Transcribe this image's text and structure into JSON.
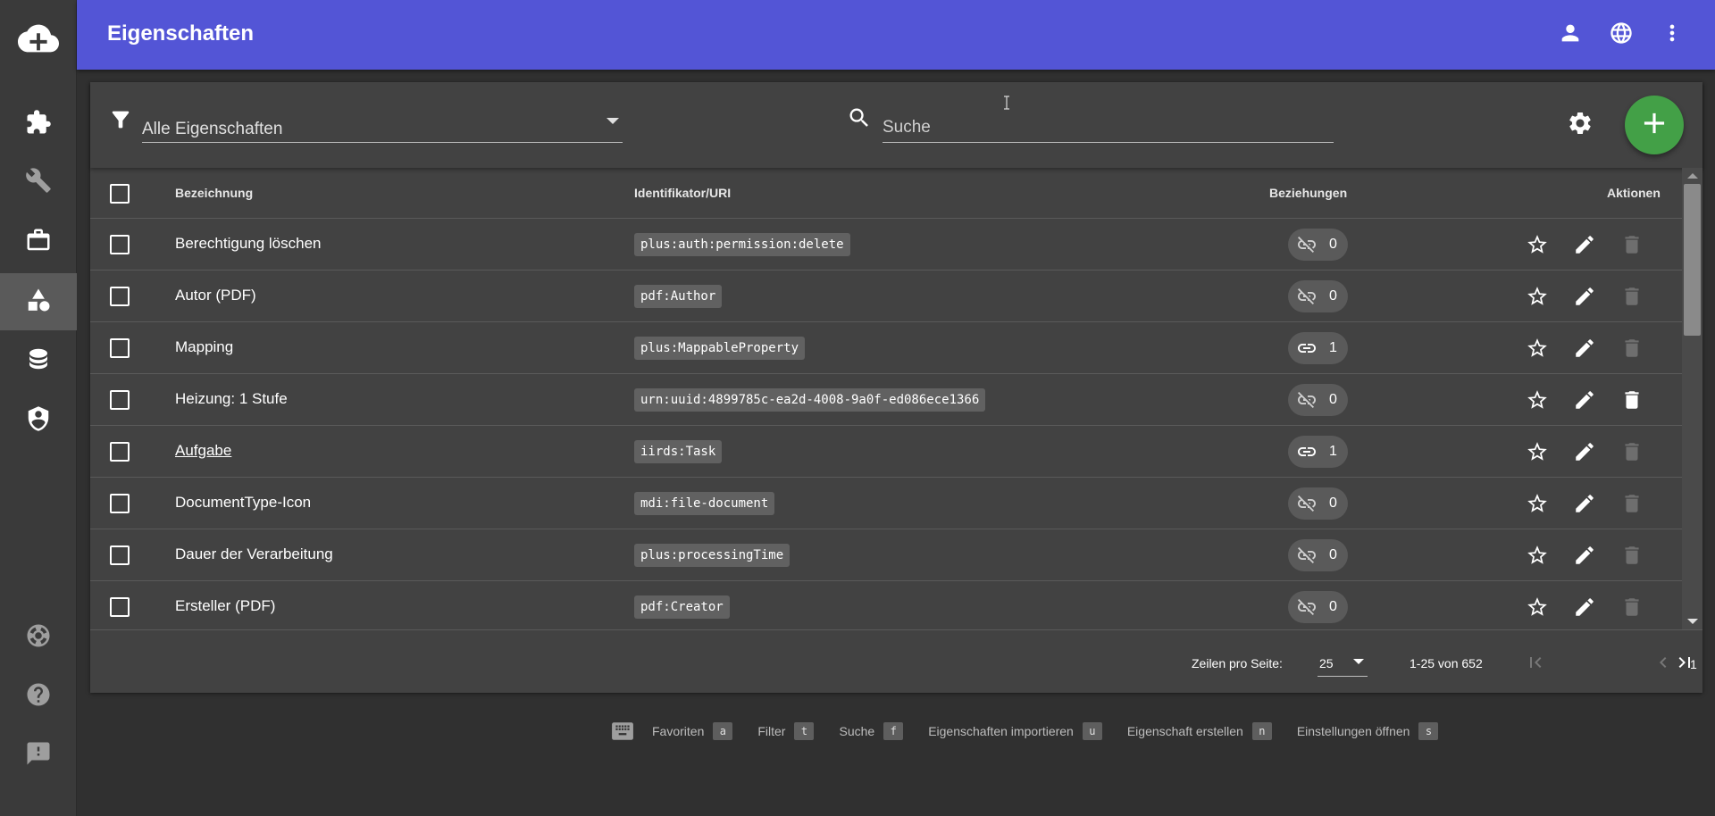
{
  "app": {
    "title": "Eigenschaften"
  },
  "sidebar": {
    "items": [
      {
        "name": "extensions",
        "icon": "puzzle-icon"
      },
      {
        "name": "tools",
        "icon": "wrench-icon"
      },
      {
        "name": "workspace",
        "icon": "briefcase-icon"
      },
      {
        "name": "properties",
        "icon": "shapes-icon",
        "active": true
      },
      {
        "name": "database",
        "icon": "database-icon"
      },
      {
        "name": "security",
        "icon": "shield-account-icon"
      },
      {
        "name": "support",
        "icon": "lifebuoy-icon"
      },
      {
        "name": "help",
        "icon": "help-circle-icon"
      },
      {
        "name": "feedback",
        "icon": "feedback-icon"
      }
    ]
  },
  "toolbar": {
    "filter_value": "Alle Eigenschaften",
    "search_placeholder": "Suche"
  },
  "table": {
    "headers": {
      "name": "Bezeichnung",
      "uri": "Identifikator/URI",
      "relations": "Beziehungen",
      "actions": "Aktionen"
    },
    "rows": [
      {
        "name": "Berechtigung löschen",
        "uri": "plus:auth:permission:delete",
        "relations": "0",
        "linked": false,
        "delete_enabled": false
      },
      {
        "name": "Autor (PDF)",
        "uri": "pdf:Author",
        "relations": "0",
        "linked": false,
        "delete_enabled": false
      },
      {
        "name": "Mapping",
        "uri": "plus:MappableProperty",
        "relations": "1",
        "linked": true,
        "delete_enabled": false
      },
      {
        "name": "Heizung: 1 Stufe",
        "uri": "urn:uuid:4899785c-ea2d-4008-9a0f-ed086ece1366",
        "relations": "0",
        "linked": false,
        "delete_enabled": true
      },
      {
        "name": "Aufgabe ",
        "uri": "iirds:Task",
        "relations": "1",
        "linked": true,
        "delete_enabled": false,
        "hovered": true
      },
      {
        "name": "DocumentType-Icon",
        "uri": "mdi:file-document",
        "relations": "0",
        "linked": false,
        "delete_enabled": false
      },
      {
        "name": "Dauer der Verarbeitung",
        "uri": "plus:processingTime",
        "relations": "0",
        "linked": false,
        "delete_enabled": false
      },
      {
        "name": "Ersteller (PDF)",
        "uri": "pdf:Creator",
        "relations": "0",
        "linked": false,
        "delete_enabled": false
      }
    ]
  },
  "pagination": {
    "rows_per_page_label": "Zeilen pro Seite:",
    "rows_per_page": "25",
    "range": "1-25 von 652",
    "page": "1"
  },
  "shortcuts": [
    {
      "label": "Favoriten",
      "key": "a"
    },
    {
      "label": "Filter",
      "key": "t"
    },
    {
      "label": "Suche",
      "key": "f"
    },
    {
      "label": "Eigenschaften importieren",
      "key": "u"
    },
    {
      "label": "Eigenschaft erstellen",
      "key": "n"
    },
    {
      "label": "Einstellungen öffnen",
      "key": "s"
    }
  ],
  "colors": {
    "topbar": "#5355d6",
    "background": "#303030",
    "card": "#424242",
    "fab": "#43a047"
  }
}
